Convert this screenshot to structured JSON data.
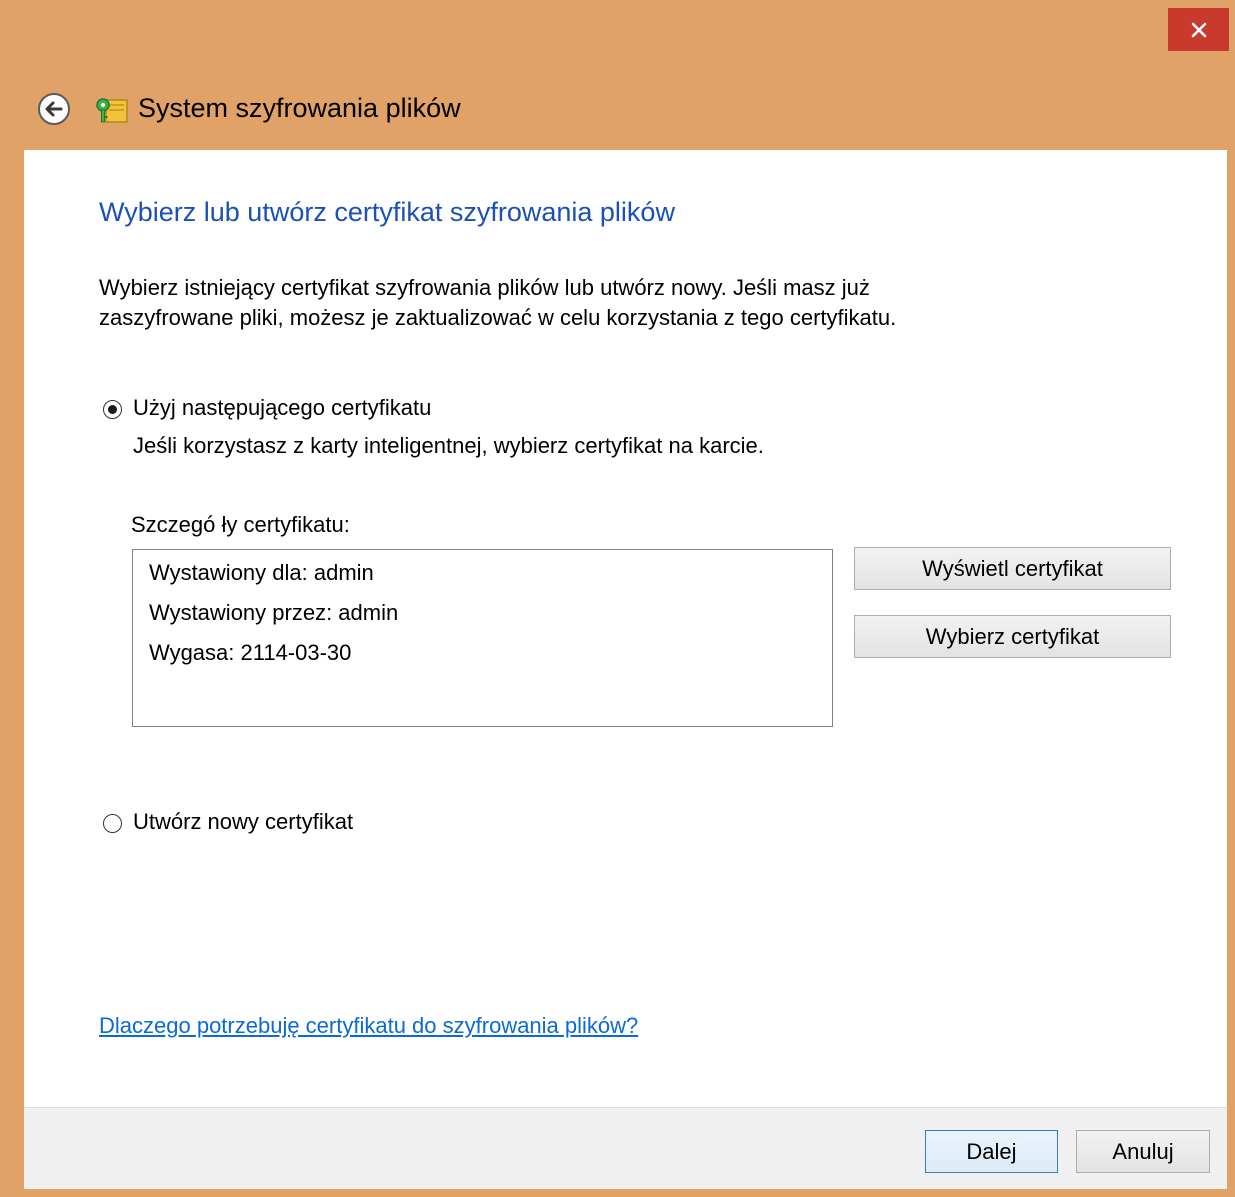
{
  "window": {
    "title": "System szyfrowania plików",
    "frame_color": "#e0a266",
    "close_color": "#c9392c"
  },
  "icons": {
    "close": "close-icon",
    "back": "back-arrow-icon",
    "app": "certificate-key-icon"
  },
  "page": {
    "heading": "Wybierz lub utwórz certyfikat szyfrowania plików",
    "intro_line1": "Wybierz istniejący certyfikat szyfrowania plików lub utwórz nowy. Jeśli masz już",
    "intro_line2": "zaszyfrowane pliki, możesz je zaktualizować w celu korzystania z tego certyfikatu.",
    "heading_color": "#1a50b8",
    "link_color": "#0b6bd3"
  },
  "options": {
    "use_existing": {
      "label": "Użyj następującego certyfikatu",
      "hint": "Jeśli korzystasz z karty inteligentnej, wybierz certyfikat na karcie.",
      "selected": true
    },
    "create_new": {
      "label": "Utwórz nowy certyfikat",
      "selected": false
    }
  },
  "details": {
    "label": "Szczegó ły certyfikatu:",
    "issued_to": "Wystawiony dla: admin",
    "issued_by": "Wystawiony przez: admin",
    "expires": "Wygasa: 2114-03-30"
  },
  "buttons": {
    "view": "Wyświetl certyfikat",
    "select": "Wybierz certyfikat",
    "next": "Dalej",
    "cancel": "Anuluj"
  },
  "help_link": "Dlaczego potrzebuję certyfikatu do szyfrowania plików?"
}
